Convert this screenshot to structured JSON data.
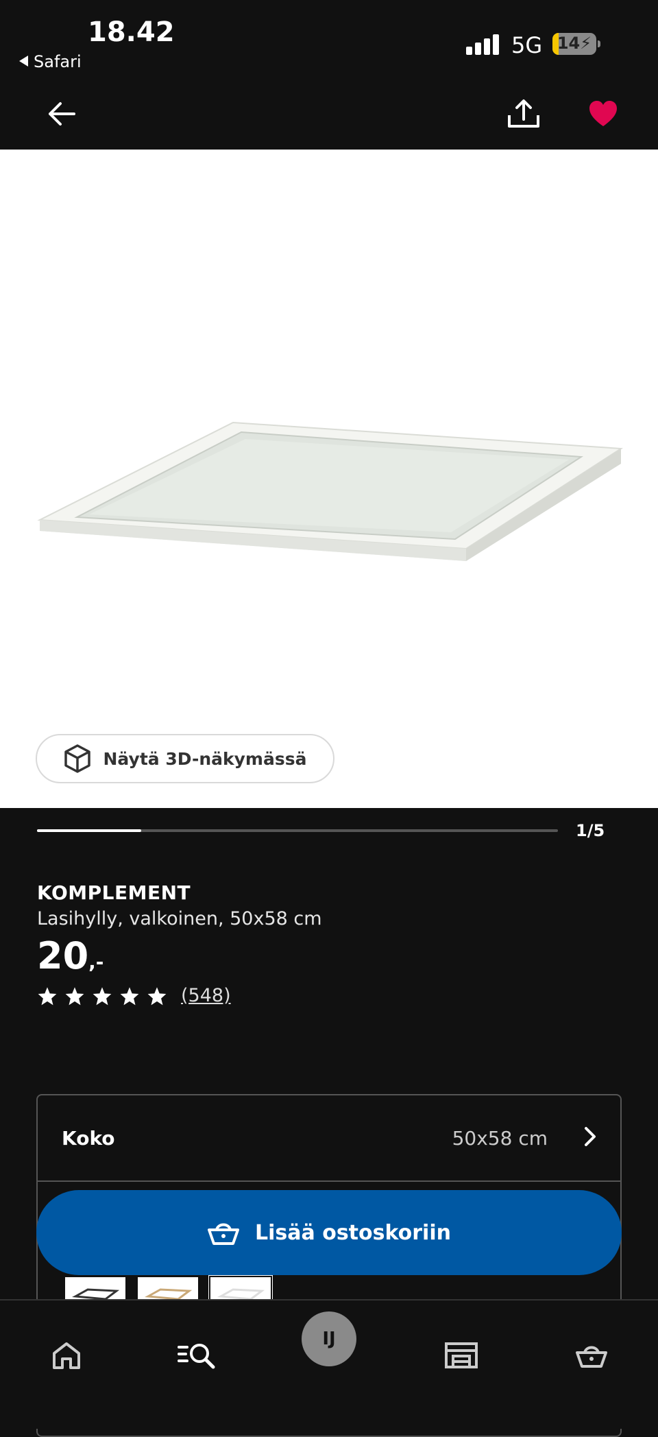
{
  "status_bar": {
    "time": "18.42",
    "back_app": "Safari",
    "network": "5G",
    "battery": "14"
  },
  "header": {
    "back_icon": "arrow-left-icon",
    "share_icon": "share-icon",
    "favorite_icon": "heart-icon",
    "favorite_color": "#e00751"
  },
  "gallery": {
    "view_3d_label": "Näytä 3D-näkymässä",
    "page_indicator": "1/5",
    "progress_fraction": 0.2
  },
  "product": {
    "name": "KOMPLEMENT",
    "description": "Lasihylly, valkoinen, 50x58 cm",
    "price_integer": "20",
    "price_decimal": ",-",
    "rating_stars": 5,
    "review_count": "(548)"
  },
  "variant": {
    "label": "Koko",
    "value": "50x58 cm"
  },
  "cart": {
    "label": "Lisää ostoskoriin",
    "button_color": "#0058a3"
  },
  "bottom_nav": {
    "items": [
      "home-icon",
      "search-icon",
      "profile-avatar",
      "store-icon",
      "basket-icon"
    ],
    "avatar_initials": "IJ"
  }
}
